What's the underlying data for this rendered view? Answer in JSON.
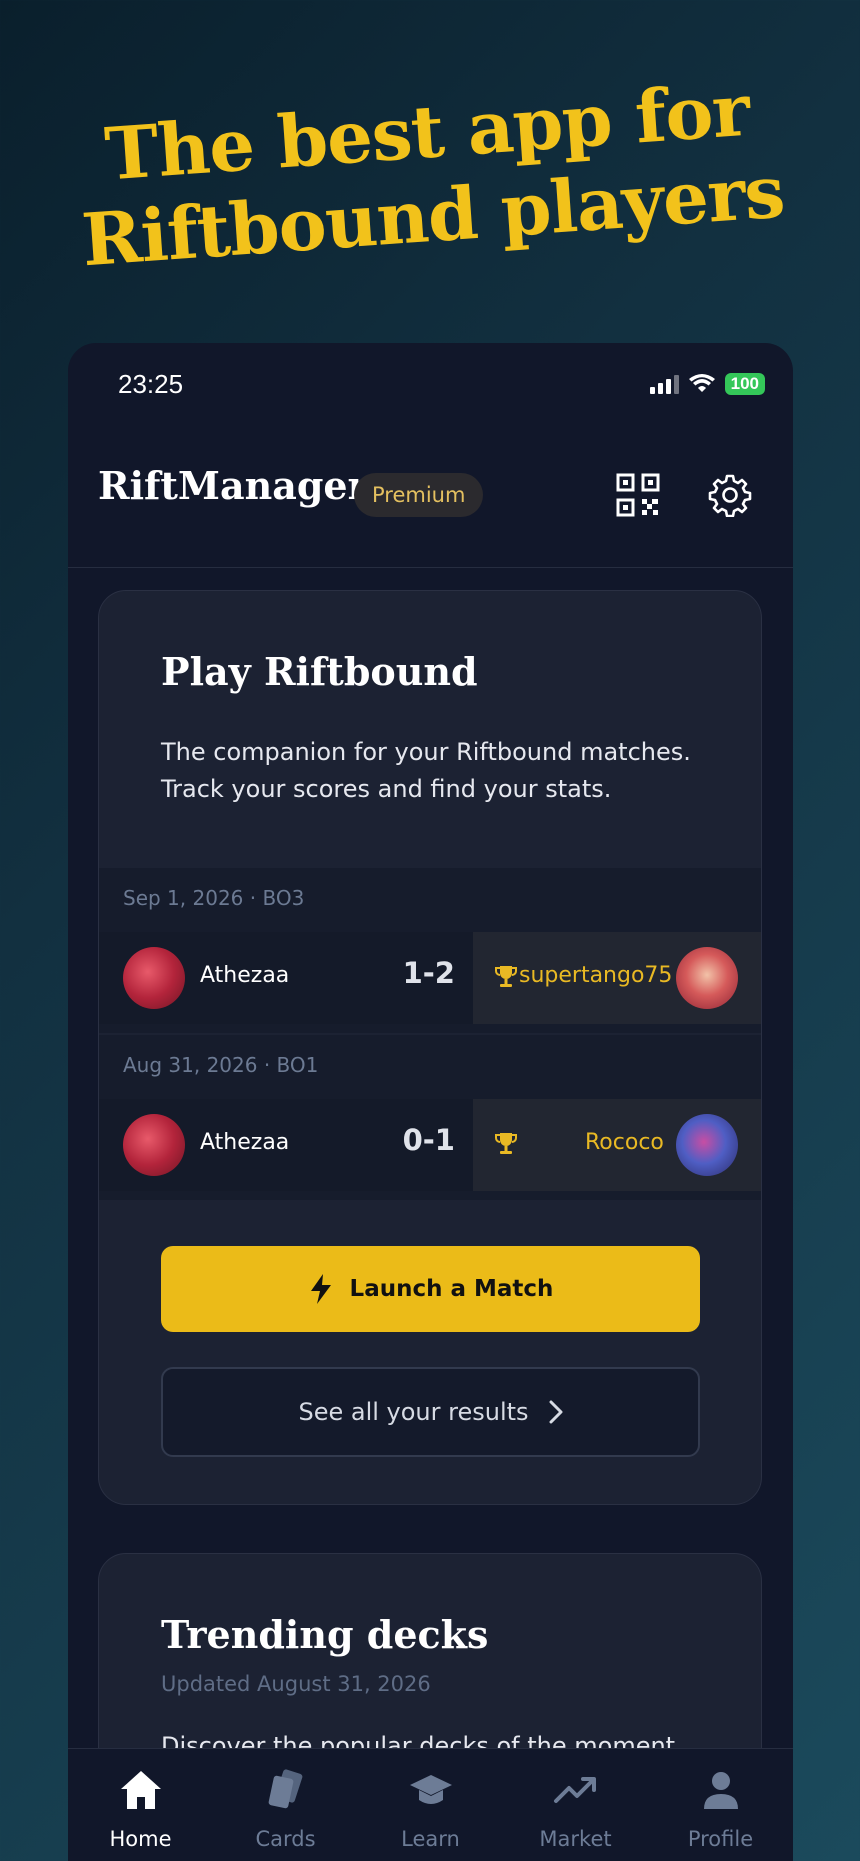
{
  "headline": {
    "line1": "The best app for",
    "line2": "Riftbound players"
  },
  "status_bar": {
    "time": "23:25",
    "battery": "100"
  },
  "header": {
    "app_title": "RiftManager",
    "badge": "Premium",
    "icons": [
      "qr-code-icon",
      "gear-icon"
    ]
  },
  "play_card": {
    "title": "Play Riftbound",
    "description": "The companion for your Riftbound matches. Track your scores and find your stats.",
    "matches": [
      {
        "meta": "Sep 1, 2026 · BO3",
        "player": "Athezaa",
        "score": "1-2",
        "opponent": "supertango75"
      },
      {
        "meta": "Aug 31, 2026 · BO1",
        "player": "Athezaa",
        "score": "0-1",
        "opponent": "Rococo"
      }
    ],
    "launch_label": "Launch a Match",
    "results_label": "See all your results"
  },
  "trending_card": {
    "title": "Trending decks",
    "updated": "Updated August 31, 2026",
    "description_partial": "Discover the popular decks of the moment"
  },
  "tabbar": {
    "items": [
      {
        "label": "Home",
        "icon": "home-icon",
        "active": true
      },
      {
        "label": "Cards",
        "icon": "cards-icon",
        "active": false
      },
      {
        "label": "Learn",
        "icon": "graduation-cap-icon",
        "active": false
      },
      {
        "label": "Market",
        "icon": "trending-up-icon",
        "active": false
      },
      {
        "label": "Profile",
        "icon": "user-icon",
        "active": false
      }
    ]
  },
  "colors": {
    "accent": "#ebbb18",
    "headline": "#f2c21b",
    "winner": "#e9b924",
    "battery": "#34c759"
  }
}
